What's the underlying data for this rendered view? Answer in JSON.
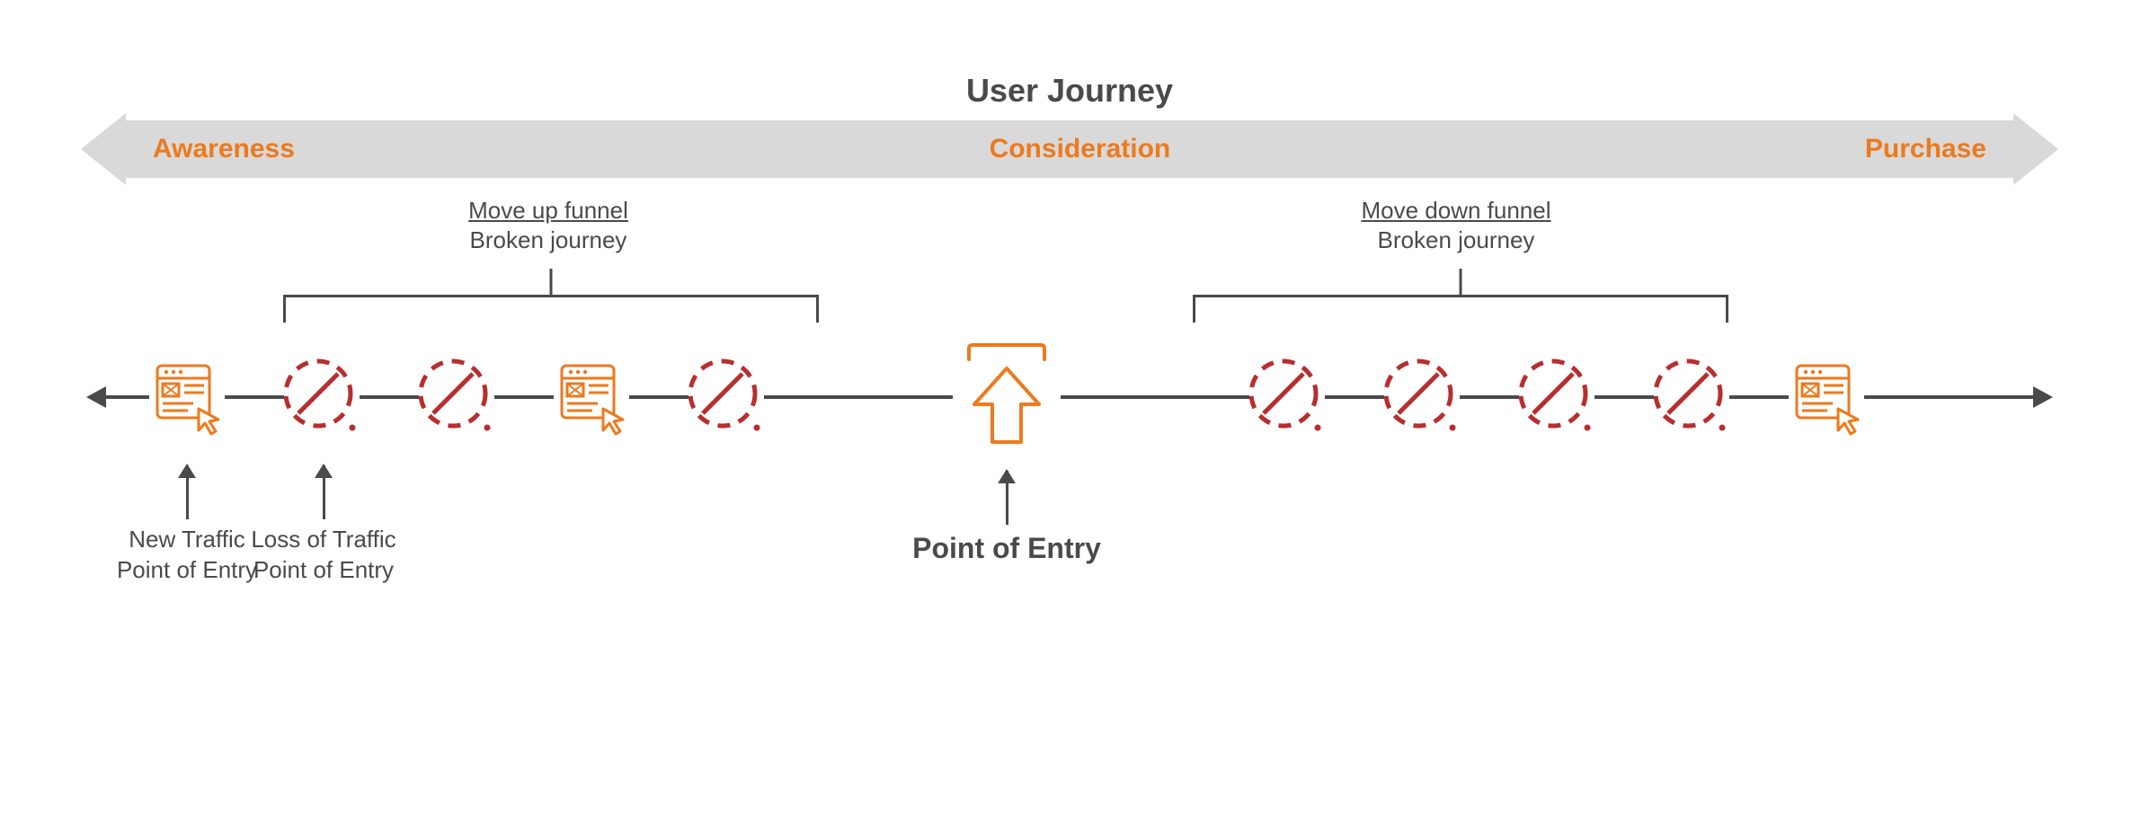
{
  "title": "User Journey",
  "stages": {
    "awareness": "Awareness",
    "consideration": "Consideration",
    "purchase": "Purchase"
  },
  "annotations": {
    "up": {
      "line1": "Move up funnel",
      "line2": "Broken journey"
    },
    "down": {
      "line1": "Move down funnel",
      "line2": "Broken journey"
    }
  },
  "callouts": {
    "new_traffic": "New Traffic Point of Entry",
    "loss_traffic": "Loss of Traffic Point of Entry",
    "point_of_entry": "Point of Entry"
  },
  "colors": {
    "accent": "#ec7a1e",
    "text": "#4a4a4a",
    "loss": "#b82e2e",
    "bar": "#d9d9d9"
  },
  "icons": {
    "page": "page-click-icon",
    "loss": "loss-circle-icon",
    "entry": "entry-arrow-icon"
  }
}
